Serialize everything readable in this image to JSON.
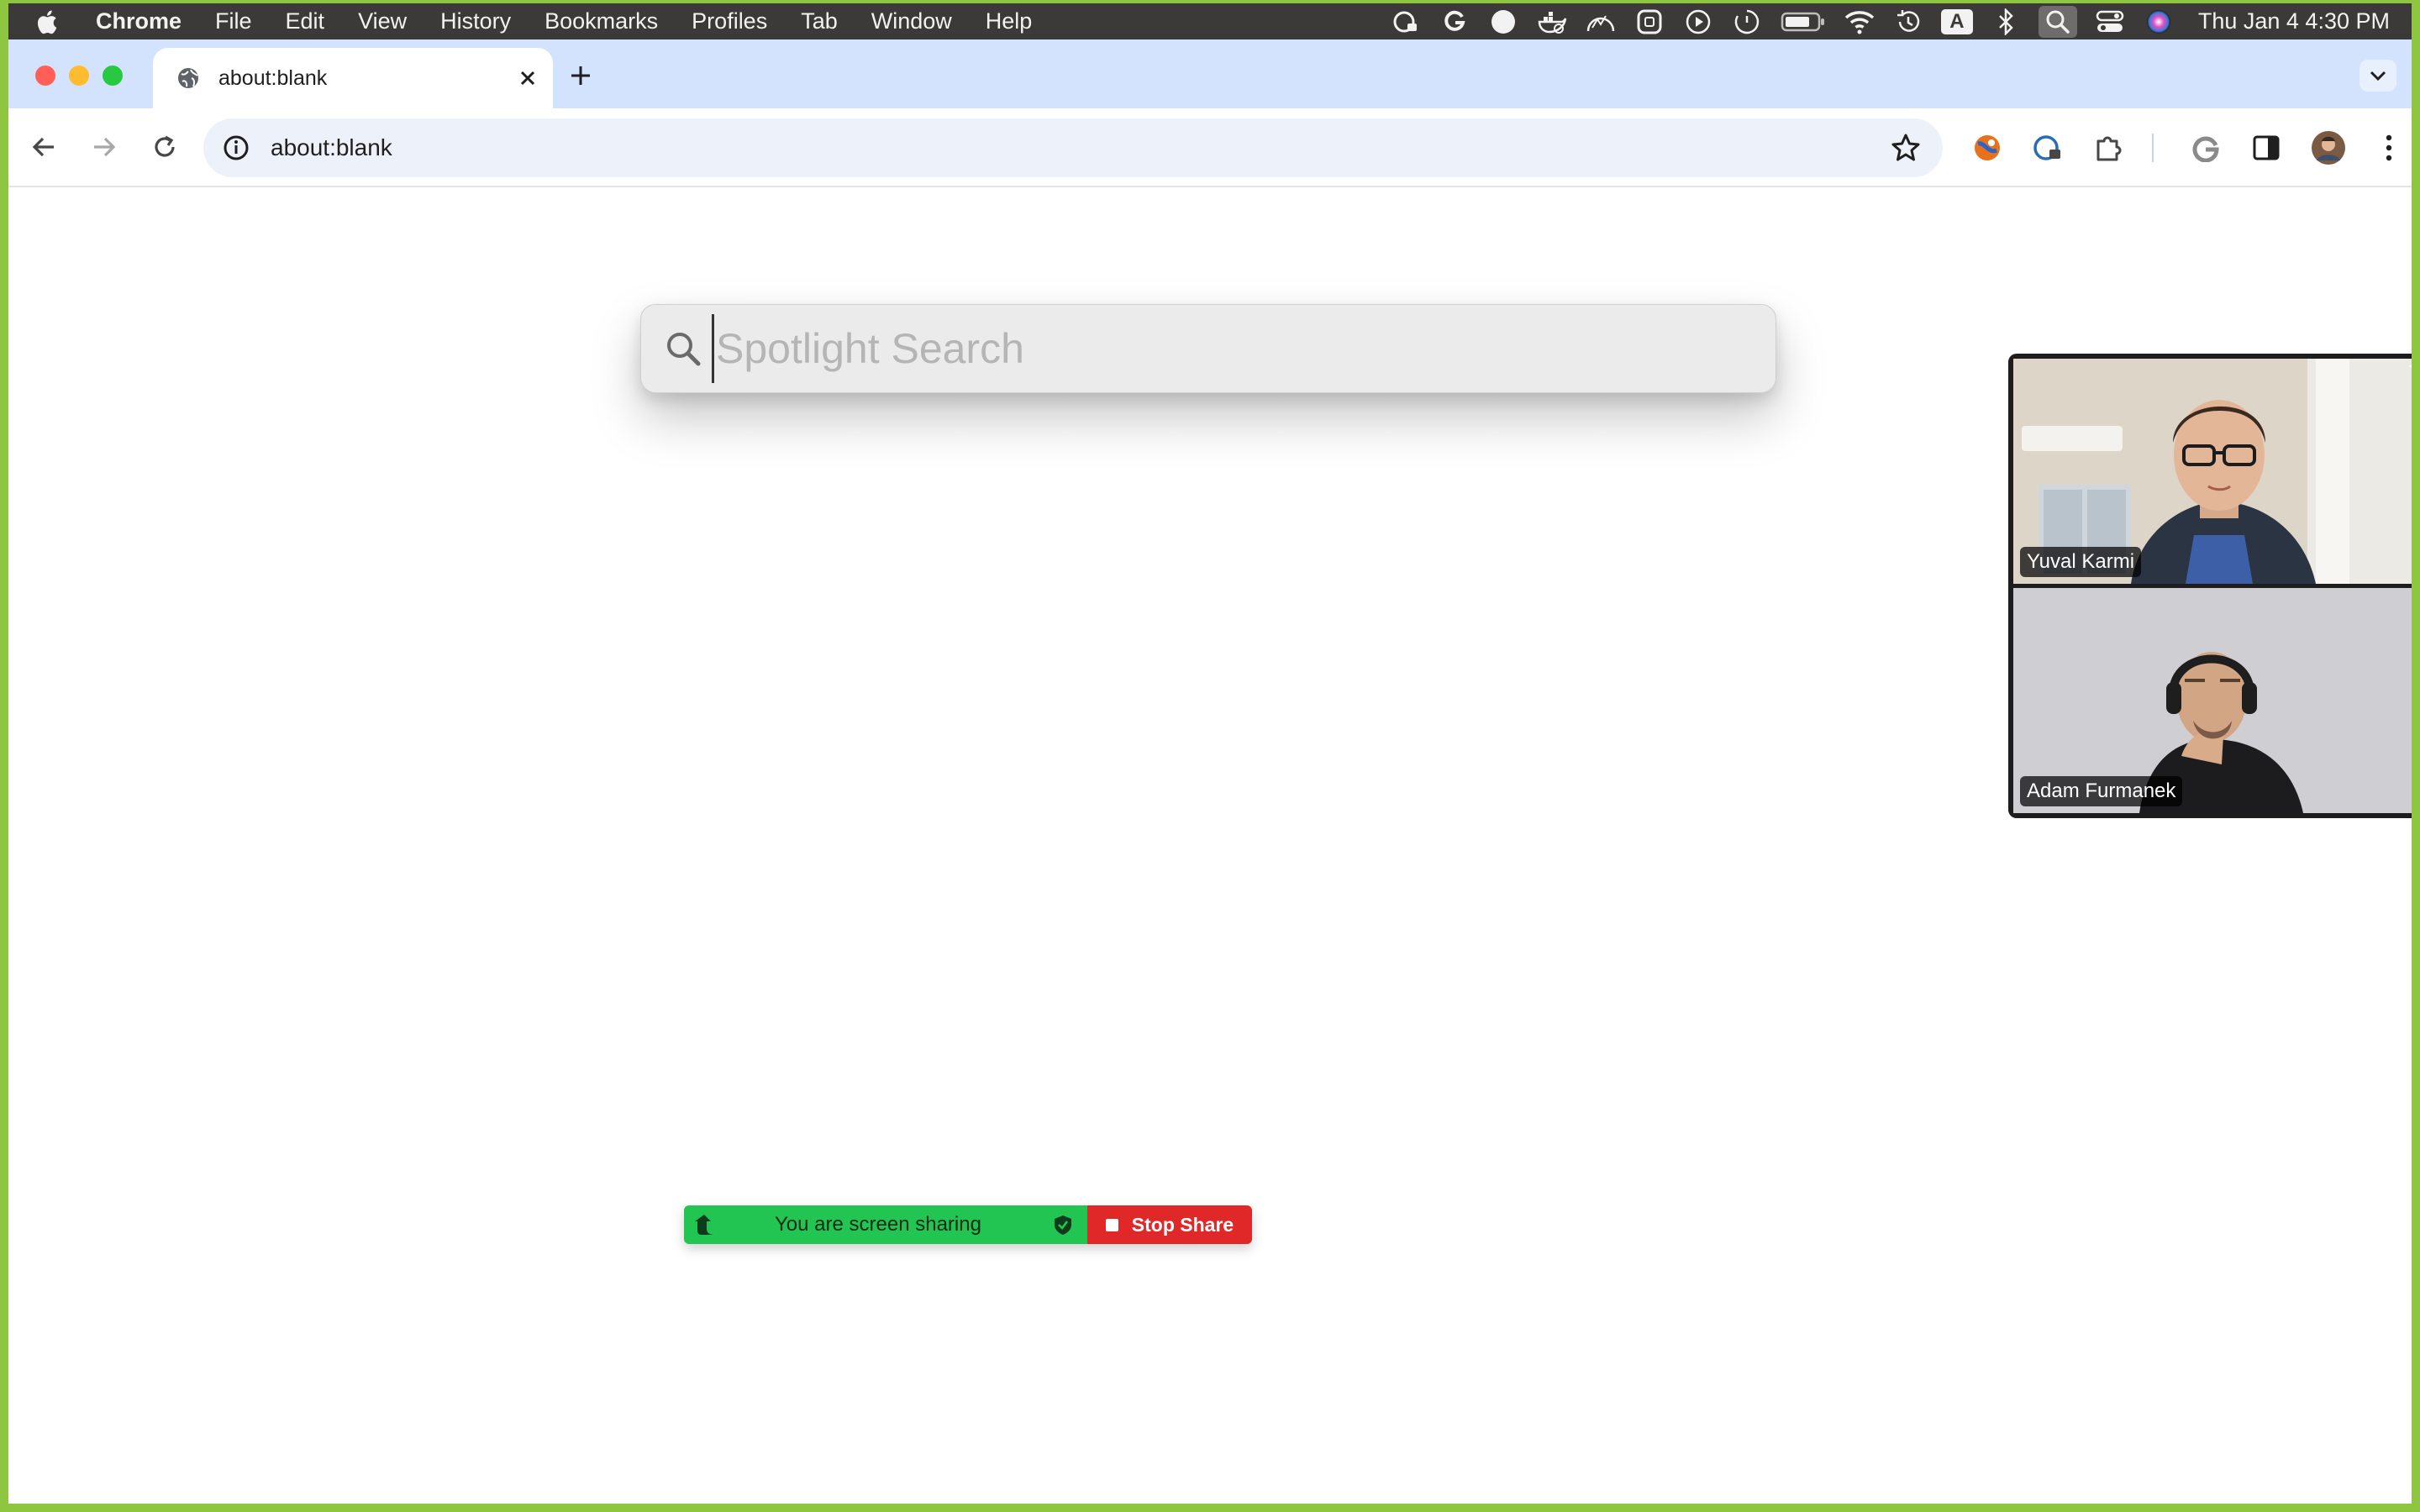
{
  "menubar": {
    "app_name": "Chrome",
    "menus": [
      "File",
      "Edit",
      "View",
      "History",
      "Bookmarks",
      "Profiles",
      "Tab",
      "Window",
      "Help"
    ],
    "status_icons": [
      "grammarly-lock-icon",
      "grammarly-icon",
      "record-dot-icon",
      "docker-icon",
      "activity-monitor-icon",
      "square-app-icon",
      "play-circle-icon",
      "clock-arc-icon",
      "battery-icon",
      "wifi-icon",
      "time-machine-icon",
      "input-source-icon",
      "bluetooth-icon",
      "spotlight-icon",
      "control-center-icon",
      "siri-icon"
    ],
    "input_source_letter": "A",
    "clock": "Thu Jan 4  4:30 PM"
  },
  "browser": {
    "tab_title": "about:blank",
    "url": "about:blank",
    "extensions": [
      "extension-colorful-icon",
      "grammarly-lock-icon",
      "puzzle-icon",
      "google-icon",
      "side-panel-icon",
      "profile-avatar",
      "kebab-menu-icon"
    ]
  },
  "spotlight": {
    "placeholder": "Spotlight Search",
    "value": ""
  },
  "video_call": {
    "participants": [
      {
        "name": "Yuval Karmi"
      },
      {
        "name": "Adam Furmanek"
      }
    ]
  },
  "share_bar": {
    "status_text": "You are screen sharing",
    "stop_label": "Stop Share"
  },
  "colors": {
    "frame_border": "#8ec63f",
    "menubar_bg": "#3b3a38",
    "tabstrip_bg": "#d3e3fd",
    "share_green": "#23c552",
    "stop_red": "#e02828"
  }
}
